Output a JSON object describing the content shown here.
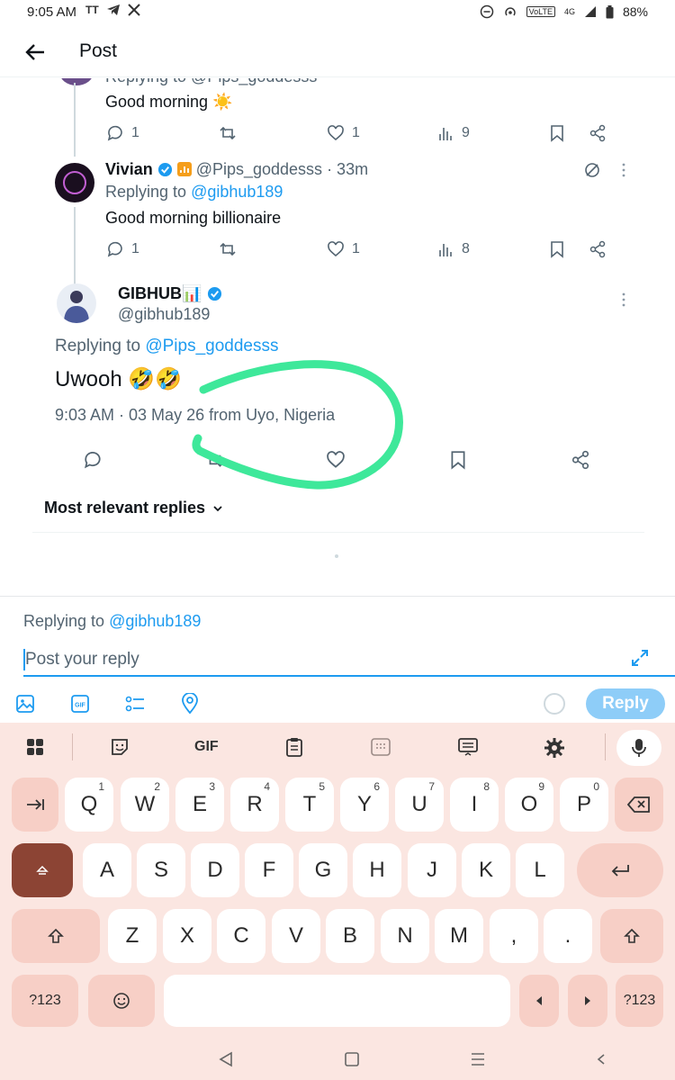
{
  "status_bar": {
    "time": "9:05 AM",
    "battery": "88%",
    "network": "4G"
  },
  "header": {
    "title": "Post"
  },
  "tweet_top": {
    "replying_partial": "Replying to @Pips_goddesss",
    "text": "Good morning ☀️",
    "replies": "1",
    "likes": "1",
    "views": "9"
  },
  "tweet_vivian": {
    "name": "Vivian",
    "handle": "@Pips_goddesss",
    "time": "· 33m",
    "replying_label": "Replying to",
    "replying_handle": "@gibhub189",
    "text": "Good morning billionaire",
    "replies": "1",
    "likes": "1",
    "views": "8"
  },
  "main_tweet": {
    "name": "GIBHUB📊",
    "handle": "@gibhub189",
    "replying_label": "Replying to",
    "replying_handle": "@Pips_goddesss",
    "text": "Uwooh 🤣🤣",
    "meta": "9:03 AM · 03 May 26 from Uyo, Nigeria"
  },
  "sort": {
    "label": "Most relevant replies"
  },
  "compose": {
    "replying_label": "Replying to",
    "replying_handle": "@gibhub189",
    "placeholder": "Post your reply",
    "reply_button": "Reply"
  },
  "keyboard": {
    "toolbar_gif": "GIF",
    "row1": [
      {
        "k": "Q",
        "n": "1"
      },
      {
        "k": "W",
        "n": "2"
      },
      {
        "k": "E",
        "n": "3"
      },
      {
        "k": "R",
        "n": "4"
      },
      {
        "k": "T",
        "n": "5"
      },
      {
        "k": "Y",
        "n": "6"
      },
      {
        "k": "U",
        "n": "7"
      },
      {
        "k": "I",
        "n": "8"
      },
      {
        "k": "O",
        "n": "9"
      },
      {
        "k": "P",
        "n": "0"
      }
    ],
    "row2": [
      "A",
      "S",
      "D",
      "F",
      "G",
      "H",
      "J",
      "K",
      "L"
    ],
    "row3": [
      "Z",
      "X",
      "C",
      "V",
      "B",
      "N",
      "M",
      ",",
      "."
    ],
    "symbols_key": "?123"
  },
  "colors": {
    "accent": "#1d9bf0",
    "highlight_circle": "#3ee89a",
    "keyboard_bg": "#fbe6e1"
  }
}
